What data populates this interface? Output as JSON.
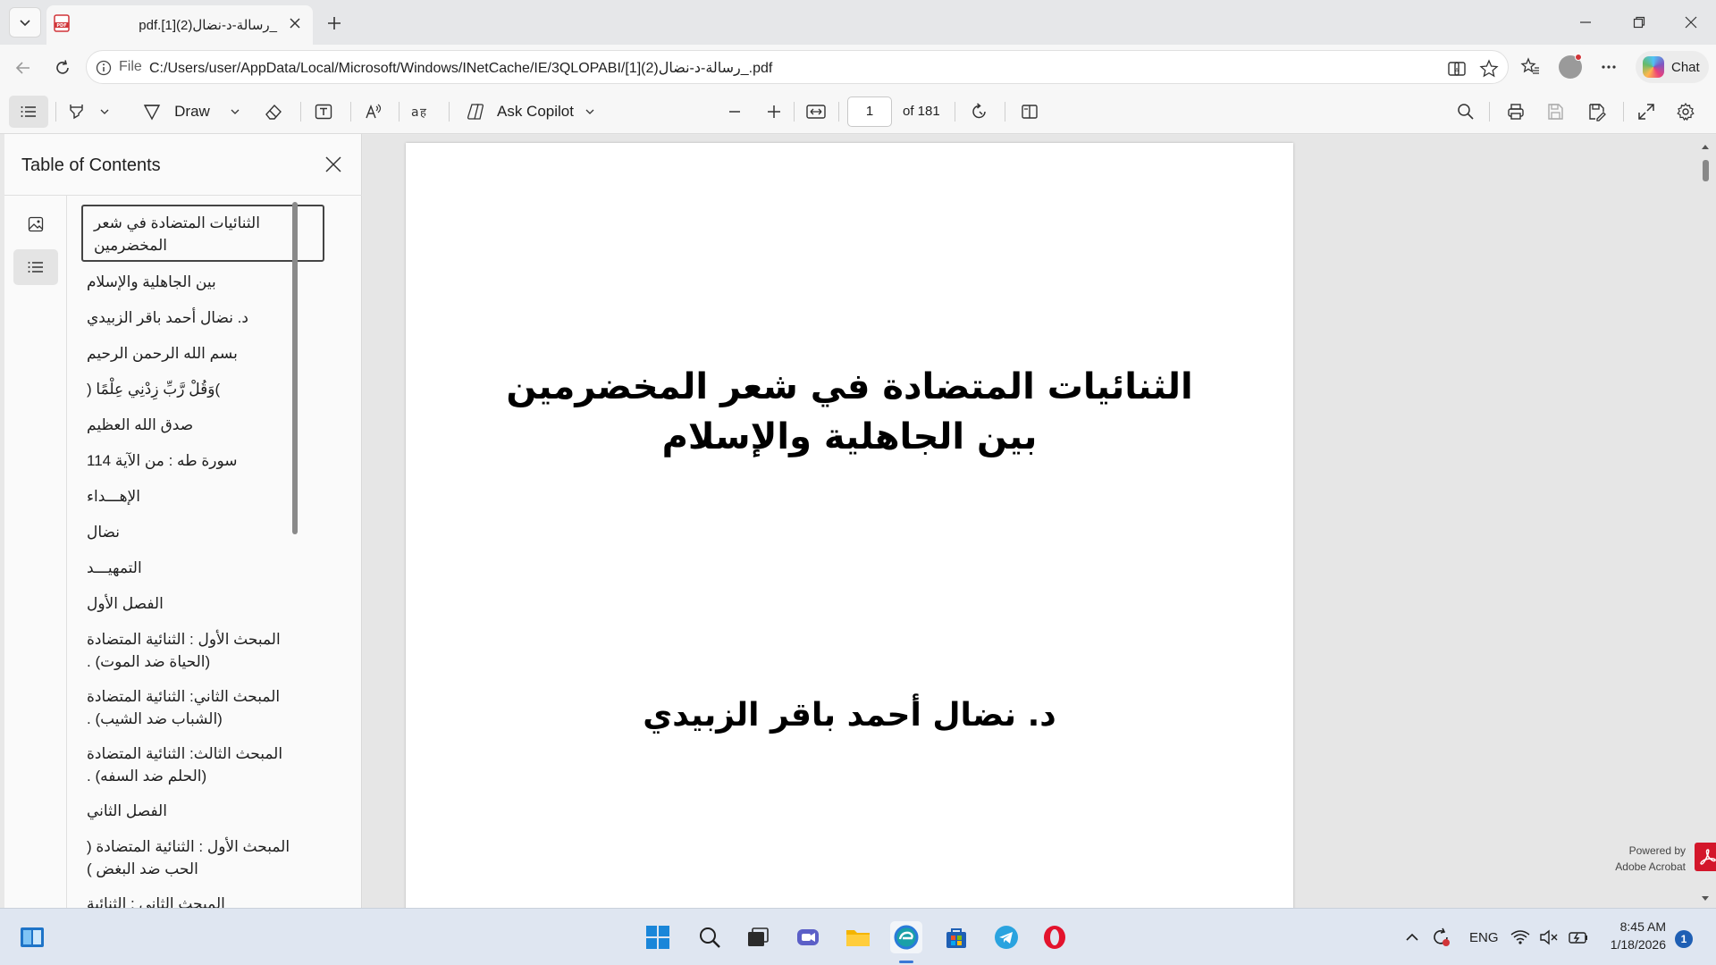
{
  "browser": {
    "tab": {
      "title": "pdf.[1](2)رسالة-د-نضال_",
      "favicon": "pdf-file-icon"
    },
    "address": {
      "scheme": "File",
      "url": "C:/Users/user/AppData/Local/Microsoft/Windows/INetCache/IE/3QLOPABI/[1](2)رسالة-د-نضال_.pdf"
    },
    "chat_label": "Chat"
  },
  "pdf_toolbar": {
    "draw_label": "Draw",
    "ask_copilot_label": "Ask Copilot",
    "page_number": "1",
    "page_of": "of 181"
  },
  "sidebar": {
    "title": "Table of Contents",
    "items": [
      "الثنائيات المتضادة في شعر المخضرمين",
      "بين الجاهلية والإسلام",
      "د. نضال أحمد باقر الزبيدي",
      "بسم الله الرحمن الرحيم",
      ")وَقُلْ رَّبِّ زِدْنِي عِلْمًا (",
      "صدق الله العظيم",
      "سورة طه : من الآية 114",
      "الإهـــداء",
      "نضال",
      "التمهيـــد",
      "الفصل الأول",
      "المبحث الأول : الثنائية المتضادة (الحياة ضد الموت) .",
      "المبحث الثاني: الثنائية المتضادة (الشباب ضد الشيب) .",
      "المبحث الثالث: الثنائية المتضادة (الحلم ضد السفه) .",
      "الفصل الثاني",
      "المبحث الأول : الثنائية المتضادة ( الحب ضد البغض )",
      "المبحث الثاني : الثنائية"
    ]
  },
  "document": {
    "title_line1": "الثنائيات المتضادة في شعر المخضرمين",
    "title_line2": "بين الجاهلية والإسلام",
    "author": "د. نضال أحمد باقر الزبيدي",
    "powered_by_line1": "Powered by",
    "powered_by_line2": "Adobe Acrobat"
  },
  "taskbar": {
    "language": "ENG",
    "time": "8:45 AM",
    "date": "1/18/2026",
    "notification_count": "1"
  }
}
